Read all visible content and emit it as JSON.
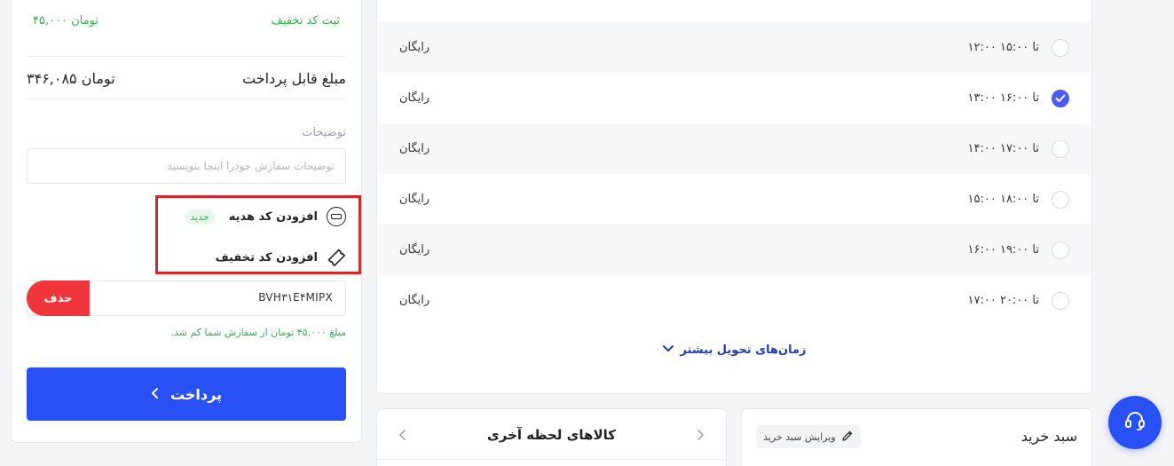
{
  "summary": {
    "discount_label": "ثبت کد تخفیف",
    "discount_amount": "۴۵,۰۰۰ تومان",
    "payable_label": "مبلغ قابل پرداخت",
    "payable_amount": "۳۴۶,۰۸۵ تومان",
    "notes_label": "توضیحات",
    "notes_placeholder": "توضیحات سفارش خودرا اینجا بنویسید",
    "add_gift_label": "افزودن کد هدیه",
    "new_badge": "جدید",
    "add_coupon_label": "افزودن کد تخفیف",
    "coupon_code": "BVH۳۱E۴MIPX",
    "delete_label": "حذف",
    "success_message": "مبلغ ۴۵,۰۰۰ تومان از سفارش شما کم شد.",
    "pay_label": "پرداخت"
  },
  "delivery": {
    "slots": [
      {
        "time": "۱۲:۰۰ تا ۱۵:۰۰",
        "price": "رایگان",
        "selected": false
      },
      {
        "time": "۱۳:۰۰ تا ۱۶:۰۰",
        "price": "رایگان",
        "selected": true
      },
      {
        "time": "۱۴:۰۰ تا ۱۷:۰۰",
        "price": "رایگان",
        "selected": false
      },
      {
        "time": "۱۵:۰۰ تا ۱۸:۰۰",
        "price": "رایگان",
        "selected": false
      },
      {
        "time": "۱۶:۰۰ تا ۱۹:۰۰",
        "price": "رایگان",
        "selected": false
      },
      {
        "time": "۱۷:۰۰ تا ۲۰:۰۰",
        "price": "رایگان",
        "selected": false
      }
    ],
    "more_times_label": "زمان‌های تحویل بیشتر"
  },
  "last_minute": {
    "title": "کالاهای لحظه آخری"
  },
  "cart": {
    "title": "سبد خرید",
    "edit_label": "ویرایش سبد خرید"
  },
  "colors": {
    "primary": "#2950f4",
    "danger": "#f0353d",
    "success": "#2cb34a",
    "highlight": "#d6262b"
  },
  "icons": [
    "gift-card-icon",
    "ticket-icon",
    "check-icon",
    "chevron-down-icon",
    "chevron-left-icon",
    "chevron-right-icon",
    "pencil-icon",
    "headset-icon"
  ]
}
